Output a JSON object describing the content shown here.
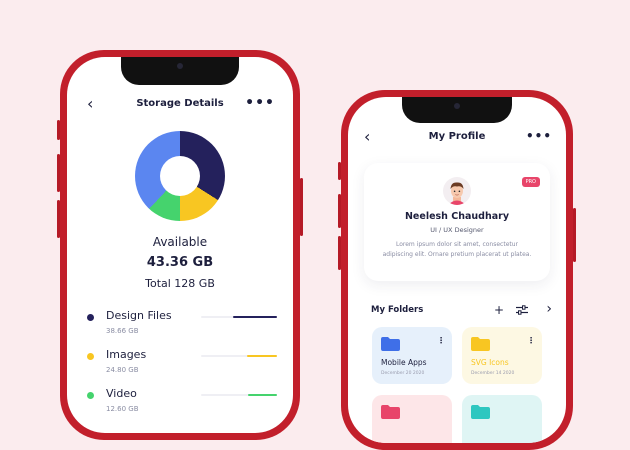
{
  "storage_screen": {
    "title": "Storage Details",
    "back_icon": "‹",
    "more_icon": "•••",
    "available_label": "Available",
    "available_value": "43.36 GB",
    "total_label": "Total 128 GB",
    "chart_segments": [
      {
        "name": "dark-navy",
        "share_percent": 34,
        "color": "#24215c"
      },
      {
        "name": "yellow",
        "share_percent": 16,
        "color": "#f8c622"
      },
      {
        "name": "green",
        "share_percent": 12,
        "color": "#45d36d"
      },
      {
        "name": "blue",
        "share_percent": 38,
        "color": "#5b86f0"
      }
    ],
    "files": [
      {
        "name": "Design Files",
        "size": "38.66 GB",
        "color": "#24215c",
        "fill_percent": 58
      },
      {
        "name": "Images",
        "size": "24.80 GB",
        "color": "#f8c622",
        "fill_percent": 40
      },
      {
        "name": "Video",
        "size": "12.60 GB",
        "color": "#45d36d",
        "fill_percent": 38
      }
    ]
  },
  "profile_screen": {
    "title": "My Profile",
    "back_icon": "‹",
    "more_icon": "•••",
    "badge": "PRO",
    "name": "Neelesh Chaudhary",
    "role": "UI / UX Designer",
    "bio": "Lorem ipsum dolor sit amet, consectetur adipiscing elit. Ornare pretium placerat ut platea.",
    "folders_label": "My Folders",
    "add_icon": "+",
    "filter_icon": "sliders",
    "next_icon": "›",
    "folders": [
      {
        "name": "Mobile Apps",
        "date": "December 20 2020",
        "bg": "#e6f0fb",
        "icon_color": "#3f6fe8",
        "text_color": "#1d1f3d"
      },
      {
        "name": "SVG Icons",
        "date": "December 14 2020",
        "bg": "#fdf8e3",
        "icon_color": "#f8c622",
        "text_color": "#f8c622"
      }
    ],
    "folder_more_icon": "⋮",
    "partial_cards": [
      {
        "bg": "#fde6e8",
        "icon_color": "#e8456a"
      },
      {
        "bg": "#dff5f4",
        "icon_color": "#2ec7c0"
      }
    ]
  }
}
